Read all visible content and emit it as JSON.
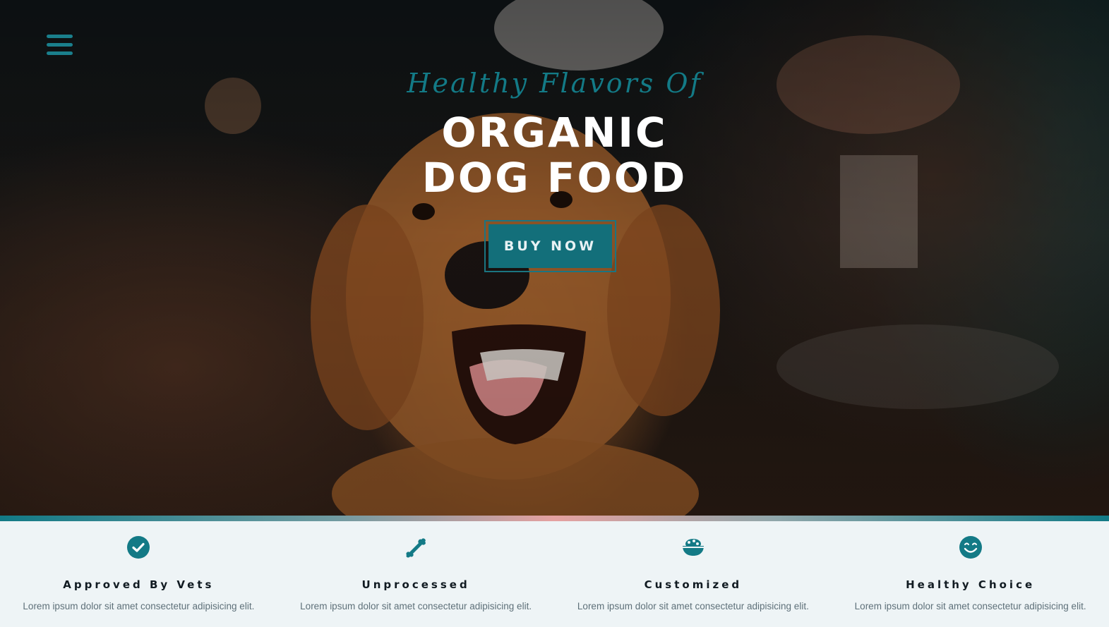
{
  "hero": {
    "tagline": "Healthy Flavors Of",
    "title_line1": "ORGANIC",
    "title_line2": "DOG FOOD",
    "cta_label": "BUY NOW",
    "menu_icon": "hamburger-menu-icon"
  },
  "features": [
    {
      "icon": "check-circle-icon",
      "title": "Approved By Vets",
      "text": "Lorem ipsum dolor sit amet consectetur adipisicing elit."
    },
    {
      "icon": "bone-icon",
      "title": "Unprocessed",
      "text": "Lorem ipsum dolor sit amet consectetur adipisicing elit."
    },
    {
      "icon": "food-bowl-icon",
      "title": "Customized",
      "text": "Lorem ipsum dolor sit amet consectetur adipisicing elit."
    },
    {
      "icon": "smile-icon",
      "title": "Healthy Choice",
      "text": "Lorem ipsum dolor sit amet consectetur adipisicing elit."
    }
  ],
  "colors": {
    "accent": "#137a86",
    "feature_title": "#111b22",
    "feature_text": "#5e7079",
    "section_bg": "#eef4f6"
  }
}
